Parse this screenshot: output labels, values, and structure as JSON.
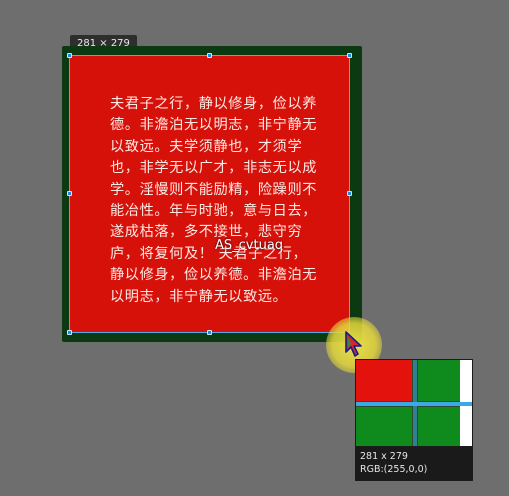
{
  "capture": {
    "dimension_badge": "281 × 279",
    "overlay_label": "AS_cvtuaq"
  },
  "content": {
    "poem": "夫君子之行，静以修身，俭以养德。非澹泊无以明志，非宁静无以致远。夫学须静也，才须学也，非学无以广才，非志无以成学。淫慢则不能励精，险躁则不能冶性。年与时驰，意与日去，遂成枯落，多不接世，悲守穷庐，将复何及！ 夫君子之行，静以修身，俭以养德。非澹泊无以明志，非宁静无以致远。"
  },
  "magnifier": {
    "size": "281 x 279",
    "rgb": "RGB:(255,0,0)"
  },
  "colors": {
    "background": "#6e6e6e",
    "frame": "#0b3a12",
    "content_red": "#d6110a",
    "selection_blue": "#1a8de0",
    "magnifier_red": "#e4120c",
    "magnifier_green": "#0f8a1c",
    "crosshair": "#3aa9e6"
  },
  "icons": {
    "cursor": "arrow-cursor-icon",
    "handles": "resize-handle-icon"
  }
}
